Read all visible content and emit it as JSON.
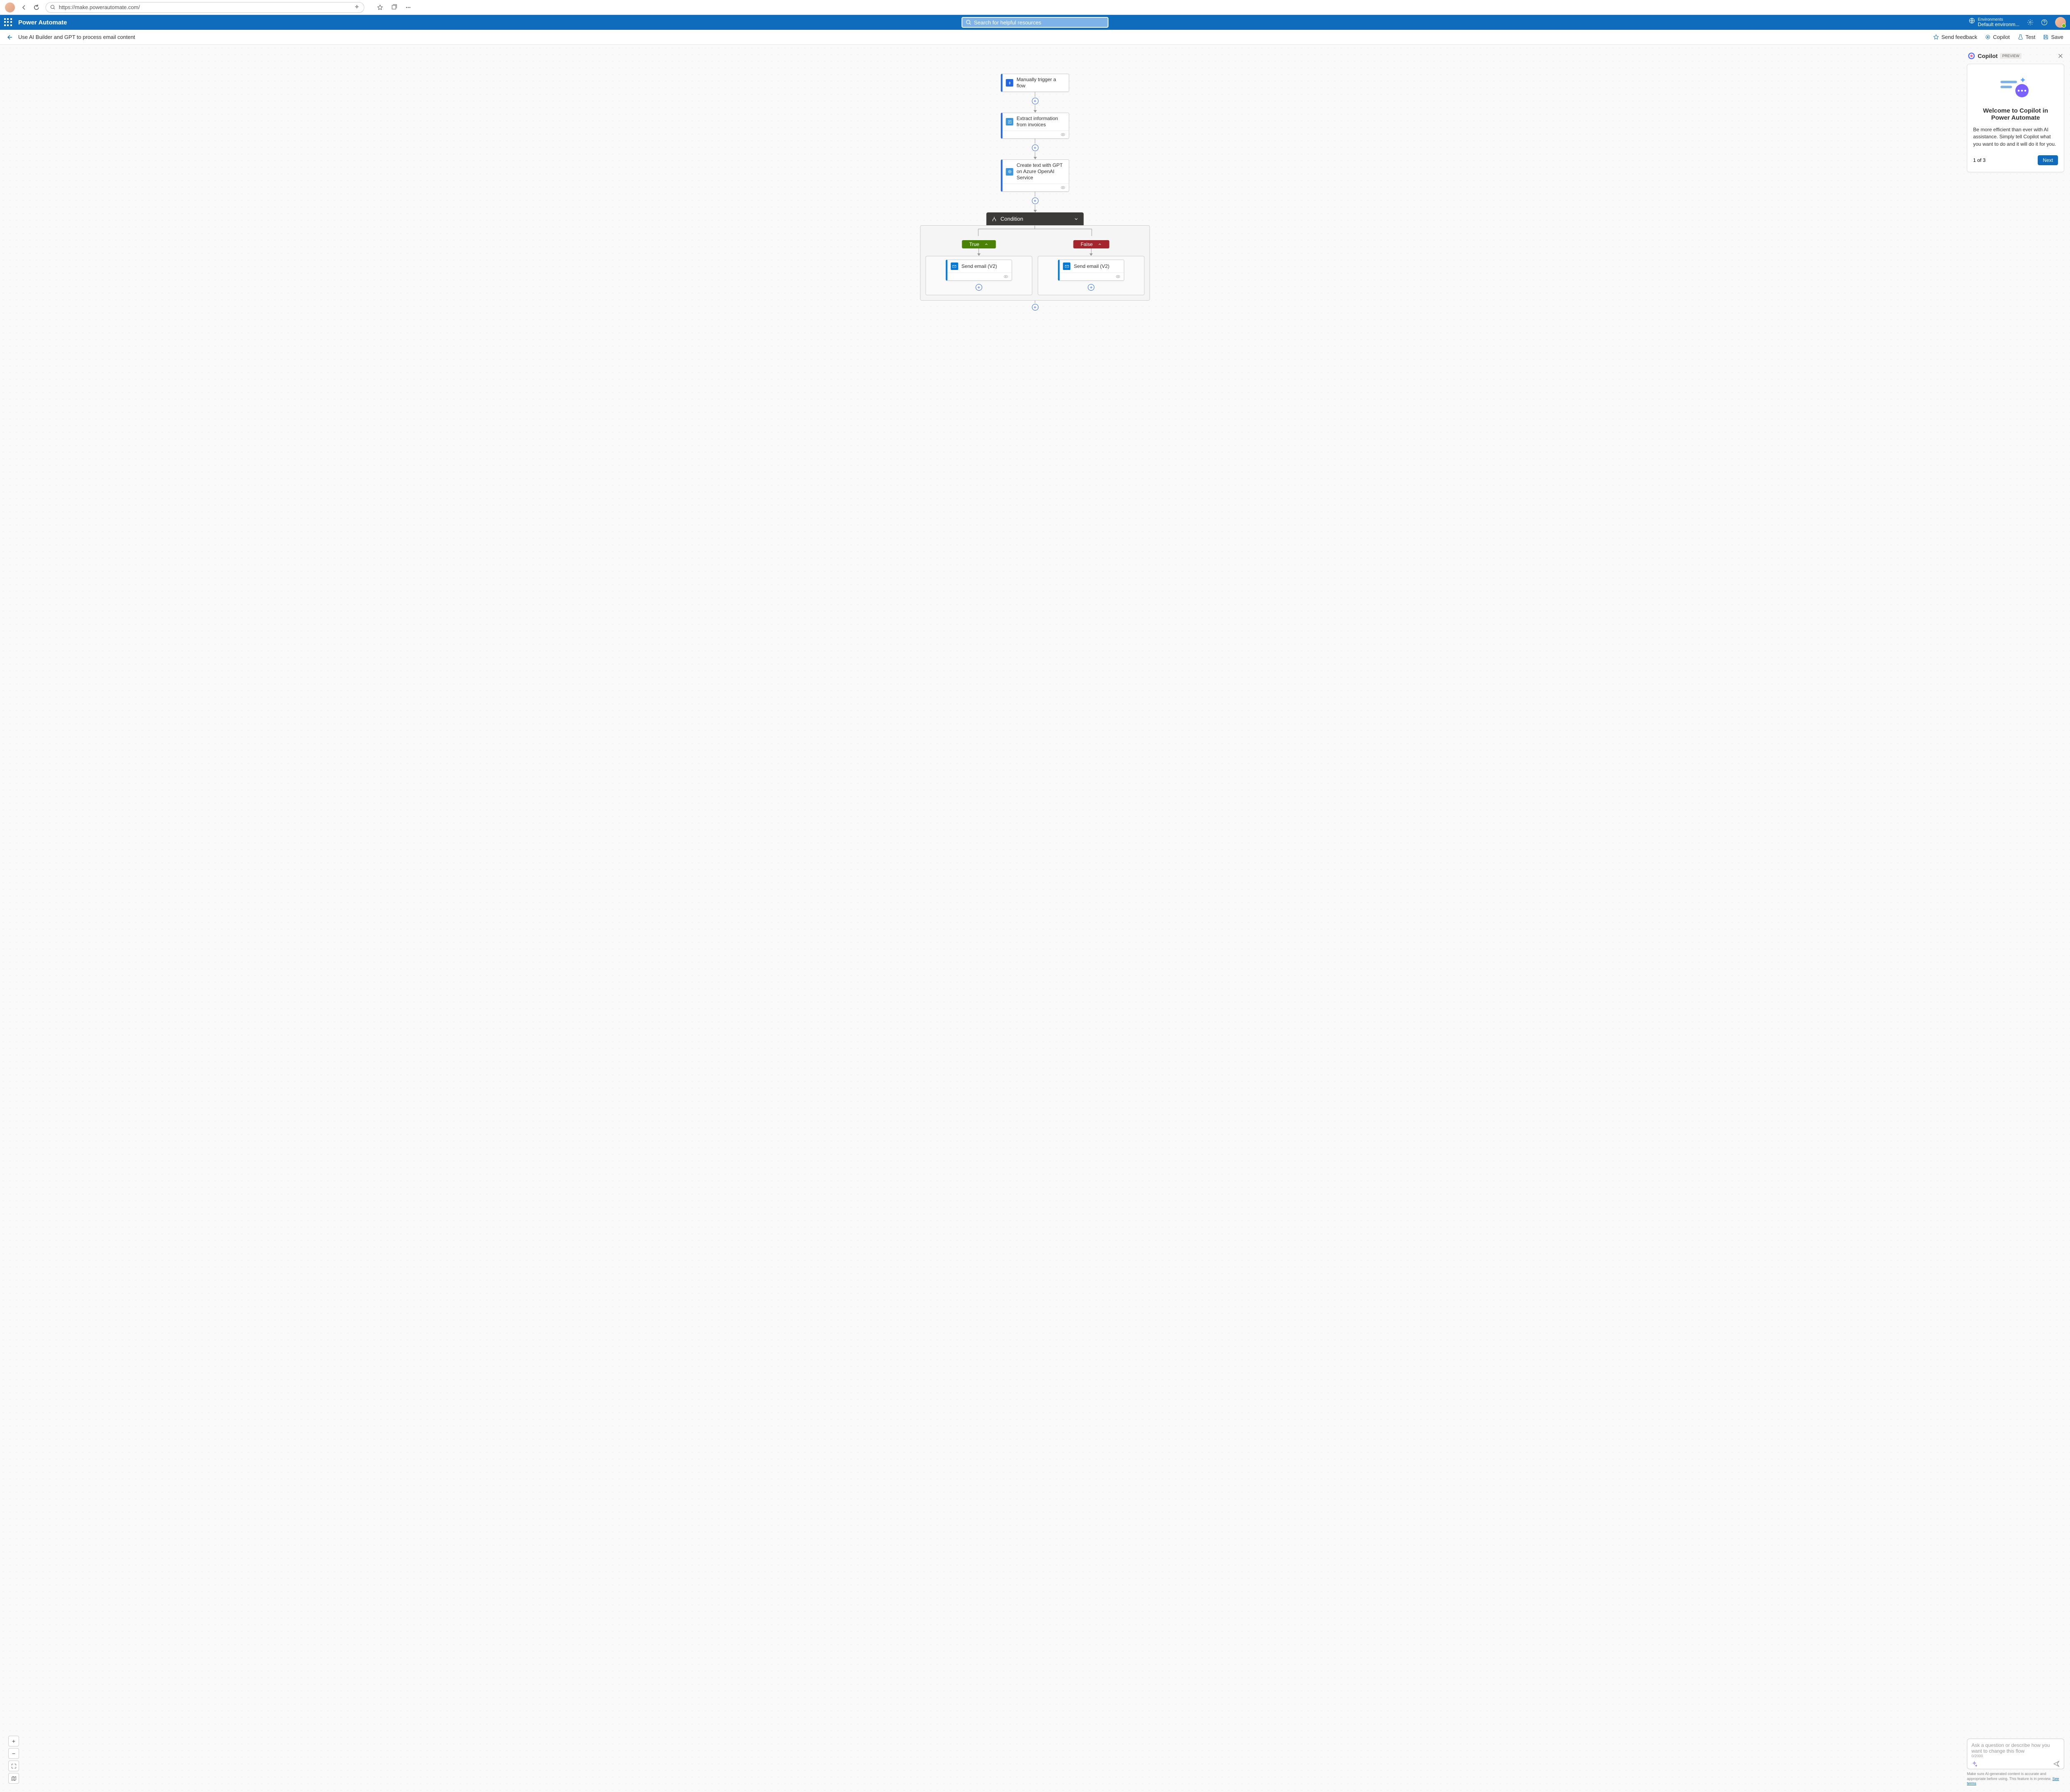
{
  "browser": {
    "url": "https://make.powerautomate.com/"
  },
  "app": {
    "title": "Power Automate",
    "search_placeholder": "Search for helpful resources",
    "env_label": "Environments",
    "env_value": "Default environm..."
  },
  "command": {
    "flow_title": "Use AI Builder and GPT to process email content",
    "feedback": "Send feedback",
    "copilot": "Copilot",
    "test": "Test",
    "save": "Save"
  },
  "flow": {
    "trigger": "Manually trigger a flow",
    "extract": "Extract information from invoices",
    "gpt": "Create text with GPT on Azure OpenAI Service",
    "condition": "Condition",
    "true_label": "True",
    "false_label": "False",
    "send_email": "Send email (V2)"
  },
  "copilot": {
    "title": "Copilot",
    "badge": "PREVIEW",
    "welcome_title": "Welcome to Copilot in Power Automate",
    "welcome_body": "Be more efficient than ever with AI assistance. Simply tell Copilot what you want to do and it will do it for you.",
    "step": "1 of 3",
    "next": "Next",
    "input_placeholder": "Ask a question or describe how you want to change this flow",
    "counter": "0/2000",
    "disclaimer_1": "Make sure AI-generated content is accurate and appropriate before using. This feature is in preview. ",
    "disclaimer_link": "See terms"
  }
}
